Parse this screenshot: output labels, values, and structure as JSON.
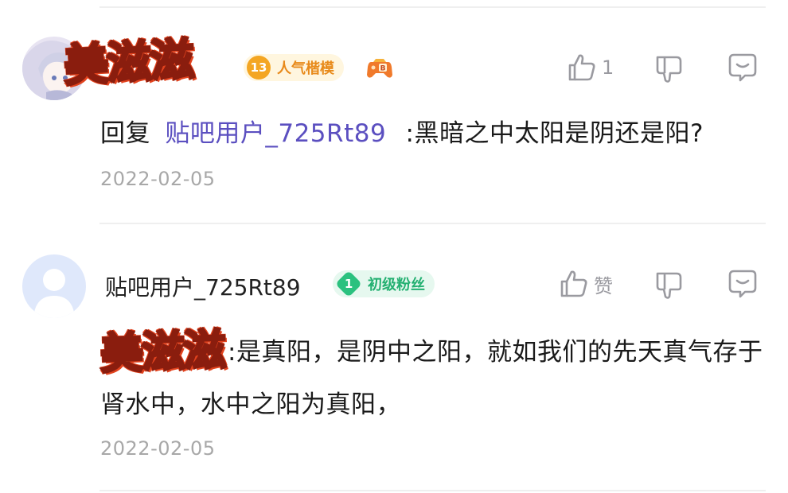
{
  "comments": [
    {
      "username": "美滋滋",
      "level": "13",
      "level_title": "人气楷模",
      "like_count": "1",
      "reply_prefix": "回复",
      "reply_target": "贴吧用户_725Rt89",
      "text": ":黑暗之中太阳是阴还是阳?",
      "date": "2022-02-05",
      "icons": [
        "avatar-anime",
        "game-controller-icon",
        "thumbs-up-icon",
        "thumbs-down-icon",
        "comment-icon"
      ]
    },
    {
      "username": "贴吧用户_725Rt89",
      "level": "1",
      "level_title": "初级粉丝",
      "like_label": "赞",
      "mention": "美滋滋",
      "text": ":是真阳，是阴中之阳，就如我们的先天真气存于肾水中，水中之阳为真阳，",
      "date": "2022-02-05",
      "icons": [
        "avatar-default",
        "thumbs-up-icon",
        "thumbs-down-icon",
        "comment-icon"
      ]
    }
  ],
  "colors": {
    "reply_link": "#5b4fc0",
    "gold_badge": "#f4a623",
    "green_badge": "#2bc17f",
    "date": "#a8a8a8",
    "icon": "#9a9aa0"
  }
}
